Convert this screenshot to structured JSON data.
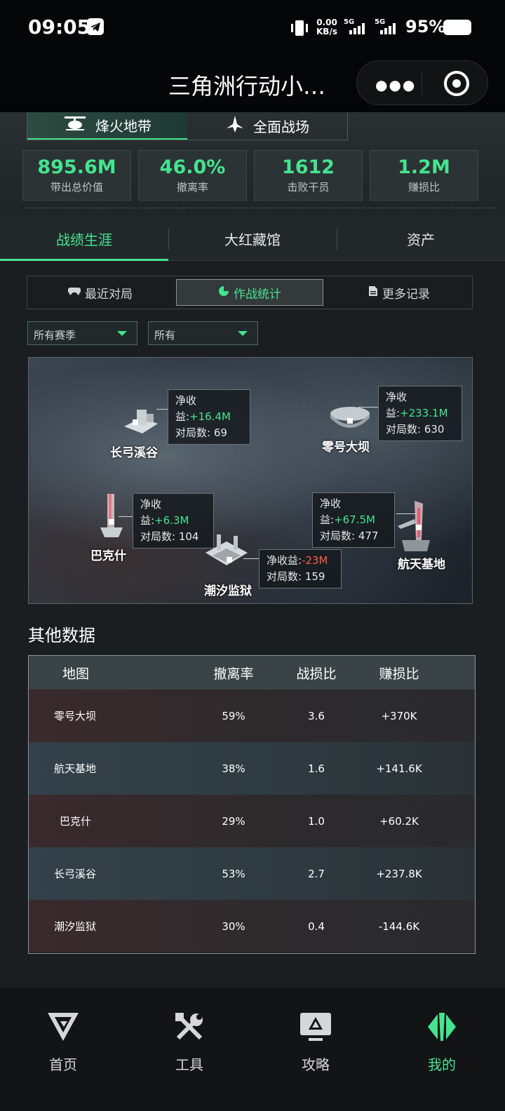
{
  "status_bar": {
    "time": "09:05",
    "net_speed_value": "0.00",
    "net_speed_unit": "KB/s",
    "signal1": "5G",
    "signal2": "5G",
    "battery": "95%"
  },
  "title_bar": {
    "title": "三角洲行动小…"
  },
  "modes": [
    {
      "label": "烽火地带",
      "active": true
    },
    {
      "label": "全面战场",
      "active": false
    }
  ],
  "stats": [
    {
      "value": "895.6M",
      "label": "带出总价值"
    },
    {
      "value": "46.0%",
      "label": "撤离率"
    },
    {
      "value": "1612",
      "label": "击败干员"
    },
    {
      "value": "1.2M",
      "label": "赚损比"
    }
  ],
  "main_tabs": [
    {
      "label": "战绩生涯",
      "active": true
    },
    {
      "label": "大红藏馆",
      "active": false
    },
    {
      "label": "资产",
      "active": false
    }
  ],
  "sub_tabs": [
    {
      "label": "最近对局",
      "icon": "gamepad-icon",
      "active": false
    },
    {
      "label": "作战统计",
      "icon": "pie-chart-icon",
      "active": true
    },
    {
      "label": "更多记录",
      "icon": "document-icon",
      "active": false
    }
  ],
  "filters": {
    "season": "所有赛季",
    "type": "所有"
  },
  "map": {
    "common": {
      "income_label": "净收益:",
      "games_label": "对局数: "
    },
    "locations": [
      {
        "name": "长弓溪谷",
        "income": "+16.4M",
        "games": "69",
        "status": "positive"
      },
      {
        "name": "零号大坝",
        "income_label": "净收\n益:",
        "income": "+233.1M",
        "games": "630",
        "status": "positive"
      },
      {
        "name": "巴克什",
        "income": "+6.3M",
        "games": "104",
        "status": "positive"
      },
      {
        "name": "航天基地",
        "income": "+67.5M",
        "games": "477",
        "status": "positive"
      },
      {
        "name": "潮汐监狱",
        "income": "-23M",
        "games": "159",
        "status": "negative"
      }
    ]
  },
  "other_data": {
    "title": "其他数据",
    "headers": [
      "地图",
      "撤离率",
      "战损比",
      "赚损比"
    ],
    "rows": [
      [
        "零号大坝",
        "59%",
        "3.6",
        "+370K"
      ],
      [
        "航天基地",
        "38%",
        "1.6",
        "+141.6K"
      ],
      [
        "巴克什",
        "29%",
        "1.0",
        "+60.2K"
      ],
      [
        "长弓溪谷",
        "53%",
        "2.7",
        "+237.8K"
      ],
      [
        "潮汐监狱",
        "30%",
        "0.4",
        "-144.6K"
      ]
    ]
  },
  "bottom_nav": [
    {
      "label": "首页",
      "icon": "home-logo-icon",
      "active": false
    },
    {
      "label": "工具",
      "icon": "tools-icon",
      "active": false
    },
    {
      "label": "攻略",
      "icon": "guide-icon",
      "active": false
    },
    {
      "label": "我的",
      "icon": "profile-icon",
      "active": true
    }
  ],
  "colors": {
    "accent": "#45e48f",
    "negative": "#ff5a4e",
    "background": "#1a1e20"
  }
}
